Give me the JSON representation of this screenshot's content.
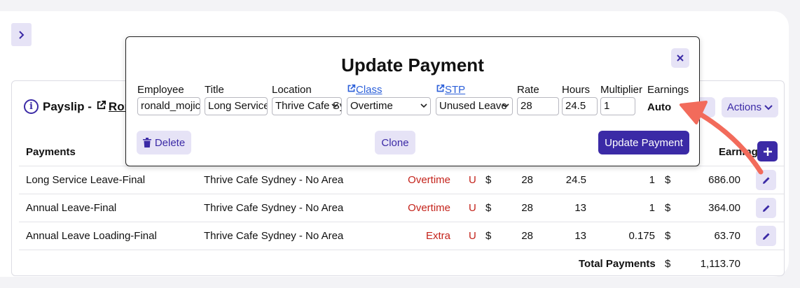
{
  "payslip": {
    "label": "Payslip -",
    "employee_link": "Ron",
    "actions_label": "Actions"
  },
  "table": {
    "headers": {
      "payments": "Payments",
      "earnings": "Earnings"
    },
    "rows": [
      {
        "payment": "Long Service Leave-Final",
        "location": "Thrive Cafe Sydney - No Area",
        "class": "Overtime",
        "stp": "U",
        "currency1": "$",
        "rate": "28",
        "hours": "24.5",
        "multiplier": "1",
        "currency2": "$",
        "earnings": "686.00"
      },
      {
        "payment": "Annual Leave-Final",
        "location": "Thrive Cafe Sydney - No Area",
        "class": "Overtime",
        "stp": "U",
        "currency1": "$",
        "rate": "28",
        "hours": "13",
        "multiplier": "1",
        "currency2": "$",
        "earnings": "364.00"
      },
      {
        "payment": "Annual Leave Loading-Final",
        "location": "Thrive Cafe Sydney - No Area",
        "class": "Extra",
        "stp": "U",
        "currency1": "$",
        "rate": "28",
        "hours": "13",
        "multiplier": "0.175",
        "currency2": "$",
        "earnings": "63.70"
      }
    ],
    "total": {
      "label": "Total Payments",
      "currency": "$",
      "value": "1,113.70"
    }
  },
  "modal": {
    "title": "Update Payment",
    "fields": {
      "employee": {
        "label": "Employee",
        "value": "ronald_mojica"
      },
      "title": {
        "label": "Title",
        "value": "Long Service Leave-Final"
      },
      "location": {
        "label": "Location",
        "value": "Thrive Cafe Sydney"
      },
      "class": {
        "label": "Class",
        "value": "Overtime"
      },
      "stp": {
        "label": "STP",
        "value": "Unused Leave"
      },
      "rate": {
        "label": "Rate",
        "value": "28"
      },
      "hours": {
        "label": "Hours",
        "value": "24.5"
      },
      "multiplier": {
        "label": "Multiplier",
        "value": "1"
      },
      "earnings": {
        "label": "Earnings",
        "value": "Auto"
      }
    },
    "buttons": {
      "delete": "Delete",
      "clone": "Clone",
      "update": "Update Payment"
    }
  },
  "colors": {
    "accent": "#3b2aa6",
    "accent_light": "#e6e3f6",
    "class_text": "#c4231b",
    "link": "#2b5fd9",
    "annotation_arrow": "#f26b5b"
  },
  "icons": [
    "chevron-right-icon",
    "info-icon",
    "external-link-icon",
    "chevron-down-icon",
    "plus-icon",
    "pencil-icon",
    "close-icon",
    "trash-icon"
  ]
}
